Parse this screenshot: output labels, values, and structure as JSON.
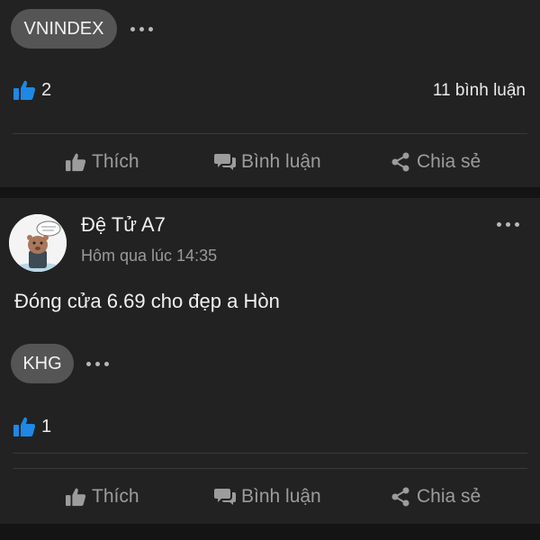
{
  "post1": {
    "tag": "VNINDEX",
    "like_count": "2",
    "comment_count": "11 bình luận"
  },
  "post2": {
    "author": "Đệ Tử A7",
    "timestamp": "Hôm qua lúc 14:35",
    "content": "Đóng cửa 6.69 cho đẹp a Hòn",
    "tag": "KHG",
    "like_count": "1"
  },
  "actions": {
    "like": "Thích",
    "comment": "Bình luận",
    "share": "Chia sẻ"
  },
  "colors": {
    "background": "#101010",
    "card": "#222222",
    "tag": "#555555",
    "like_accent": "#1e88e5",
    "action_text": "#9c9c9c"
  },
  "icons": [
    "thumbs-up-icon",
    "comment-icon",
    "share-icon",
    "more-dots-icon"
  ]
}
